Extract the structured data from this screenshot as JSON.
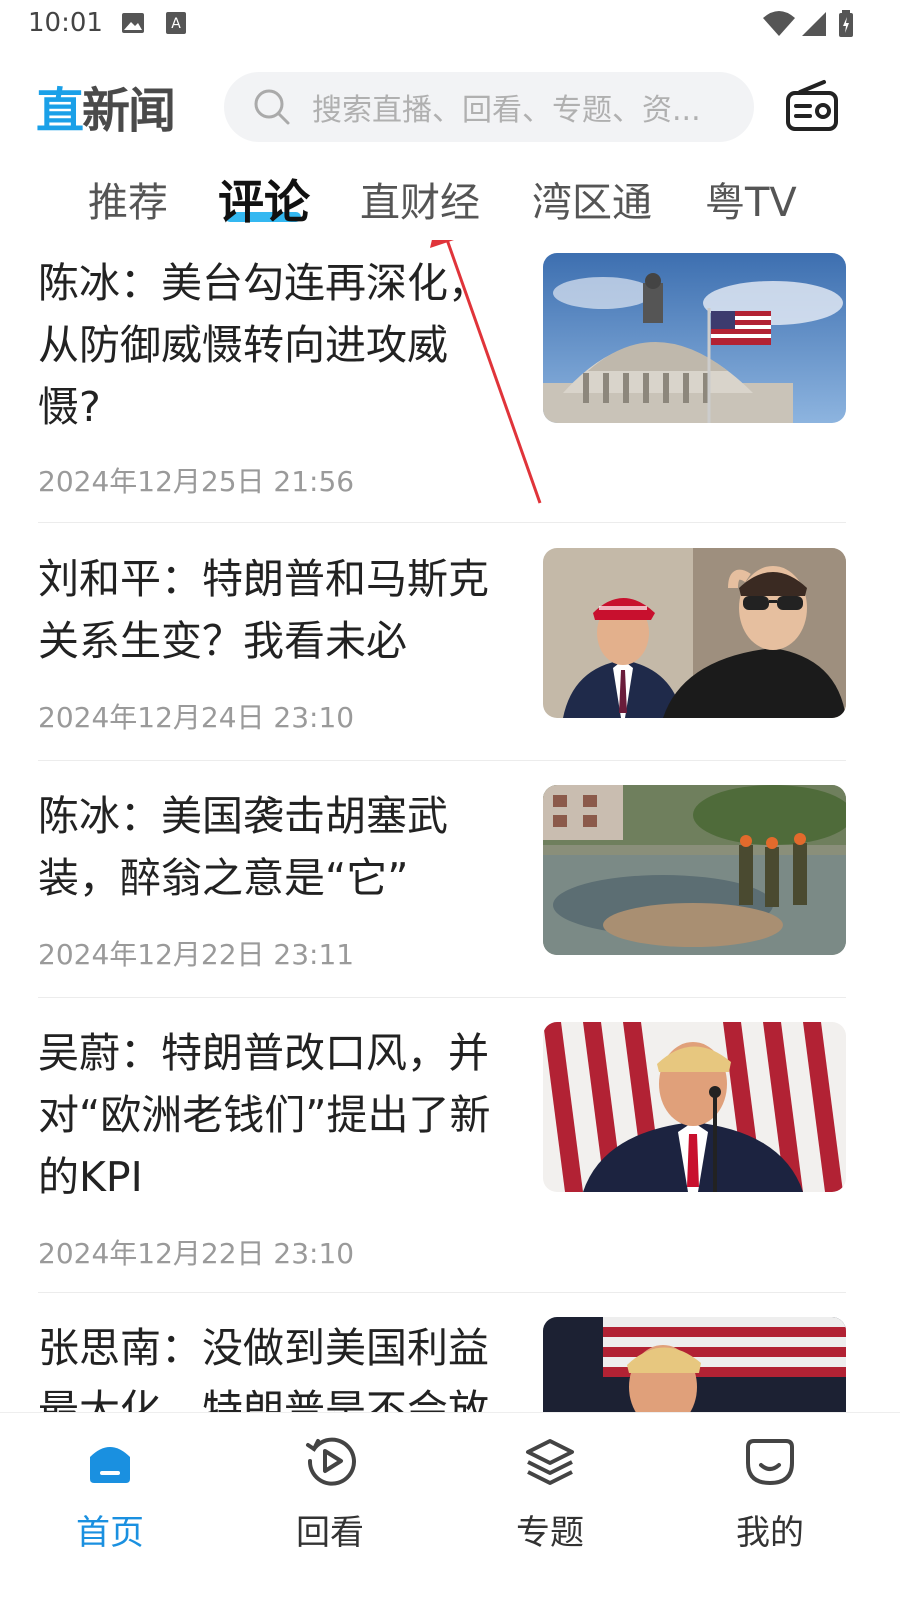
{
  "status_bar": {
    "time": "10:01",
    "left_icons": [
      "image-icon",
      "a-badge-icon"
    ],
    "right_icons": [
      "wifi-icon",
      "signal-icon",
      "battery-icon"
    ]
  },
  "header": {
    "logo_part1": "直",
    "logo_part2": "新闻",
    "search_placeholder": "搜索直播、回看、专题、资...",
    "right_icon": "radio-icon"
  },
  "tabs": [
    {
      "label": "推荐",
      "active": false
    },
    {
      "label": "评论",
      "active": true
    },
    {
      "label": "直财经",
      "active": false
    },
    {
      "label": "湾区通",
      "active": false
    },
    {
      "label": "粤TV",
      "active": false
    }
  ],
  "feed": [
    {
      "title": "陈冰：美台勾连再深化，从防御威慑转向进攻威慑?",
      "date": "2024年12月25日 21:56",
      "image": "capitol-dome-flag"
    },
    {
      "title": "刘和平：特朗普和马斯克关系生变？我看未必",
      "date": "2024年12月24日 23:10",
      "image": "trump-musk"
    },
    {
      "title": "陈冰：美国袭击胡塞武装，醉翁之意是“它”",
      "date": "2024年12月22日 23:11",
      "image": "crater-soldiers"
    },
    {
      "title": "吴蔚：特朗普改口风，并对“欧洲老钱们”提出了新的KPI",
      "date": "2024年12月22日 23:10",
      "image": "trump-podium-flags"
    },
    {
      "title": "张思南：没做到美国利益最大化，特朗普是不会放",
      "date": "",
      "image": "trump-flag"
    }
  ],
  "bottom_nav": [
    {
      "label": "首页",
      "icon": "home-icon",
      "active": true
    },
    {
      "label": "回看",
      "icon": "replay-icon",
      "active": false
    },
    {
      "label": "专题",
      "icon": "layers-icon",
      "active": false
    },
    {
      "label": "我的",
      "icon": "profile-icon",
      "active": false
    }
  ],
  "colors": {
    "accent": "#1a90e0",
    "tab_underline": "#1eb0f0",
    "annotation": "#e0343a"
  }
}
